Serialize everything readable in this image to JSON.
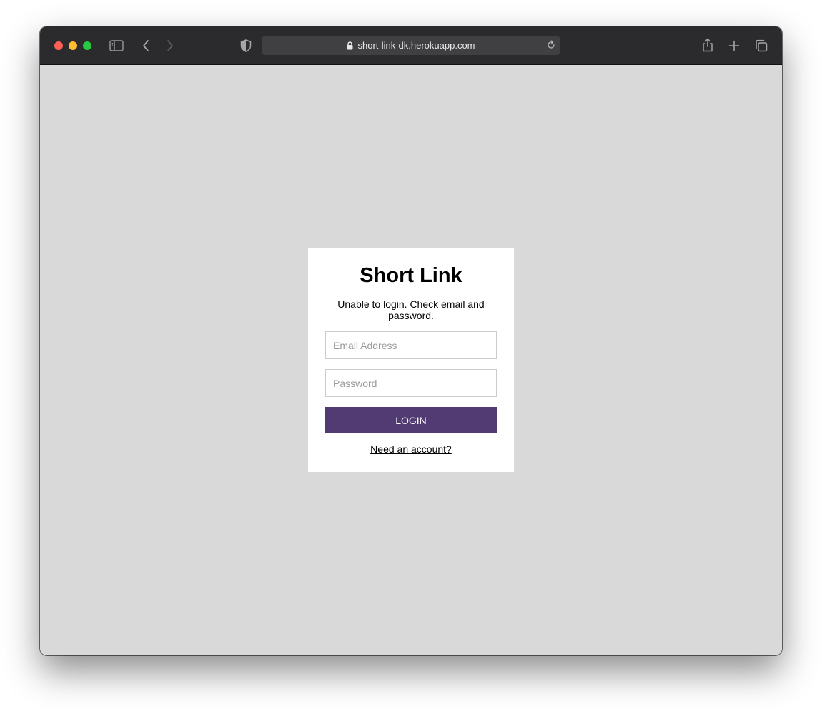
{
  "browser": {
    "url": "short-link-dk.herokuapp.com",
    "icons": [
      "sidebar-icon",
      "back-arrow-icon",
      "forward-arrow-icon",
      "privacy-shield-icon",
      "lock-icon",
      "reload-icon",
      "share-icon",
      "new-tab-plus-icon",
      "tab-overview-icon"
    ]
  },
  "login": {
    "title": "Short Link",
    "error": "Unable to login. Check email and password.",
    "email_placeholder": "Email Address",
    "email_value": "",
    "password_placeholder": "Password",
    "password_value": "",
    "login_label": "LOGIN",
    "signup_link": "Need an account?"
  },
  "colors": {
    "page_background": "#d9d9d9",
    "button": "#523b73",
    "toolbar": "#2b2b2d"
  }
}
